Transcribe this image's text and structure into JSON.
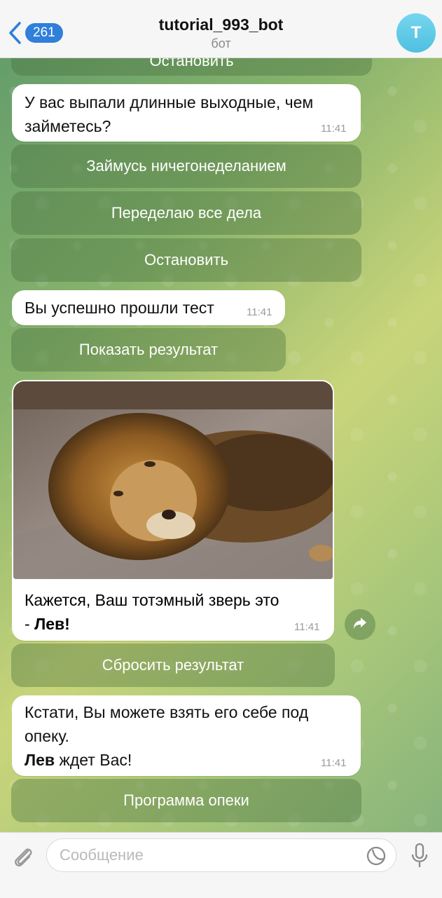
{
  "header": {
    "back_count": "261",
    "title": "tutorial_993_bot",
    "subtitle": "бот",
    "avatar_letter": "T"
  },
  "messages": {
    "top_cut_button": "Остановить",
    "m1_text": "У вас выпали длинные выходные, чем займетесь?",
    "m1_time": "11:41",
    "m1_buttons": [
      "Займусь ничегонеделанием",
      "Переделаю все дела",
      "Остановить"
    ],
    "m2_text": "Вы успешно прошли тест",
    "m2_time": "11:41",
    "m2_button": "Показать результат",
    "m3_caption_plain": "Кажется, Ваш тотэмный зверь это",
    "m3_caption_dash": "- ",
    "m3_caption_bold": "Лев!",
    "m3_time": "11:41",
    "m3_button": "Сбросить результат",
    "m4_text_line": "Кстати, Вы можете взять его себе под опеку.",
    "m4_bold": "Лев",
    "m4_rest": " ждет Вас!",
    "m4_time": "11:41",
    "m4_button": "Программа опеки"
  },
  "composer": {
    "placeholder": "Сообщение"
  },
  "colors": {
    "accent": "#2f7fdb",
    "avatar": "#5bc8e6",
    "bubble": "#ffffff"
  },
  "icons": [
    "chevron-left-icon",
    "share-icon",
    "attach-icon",
    "sticker-icon",
    "microphone-icon"
  ]
}
